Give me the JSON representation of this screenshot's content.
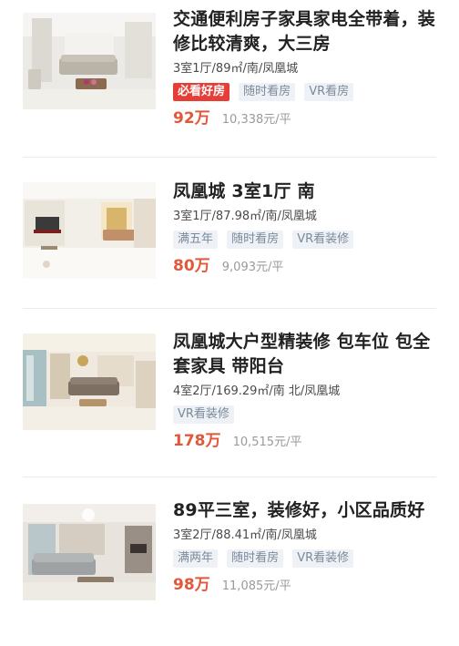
{
  "listings": [
    {
      "title": "交通便利房子家具家电全带着，装修比较清爽，大三房",
      "meta": "3室1厅/89㎡/南/凤凰城",
      "tags": [
        "必看好房",
        "随时看房",
        "VR看房"
      ],
      "price": "92万",
      "unit_price": "10,338元/平"
    },
    {
      "title": "凤凰城 3室1厅 南",
      "meta": "3室1厅/87.98㎡/南/凤凰城",
      "tags": [
        "满五年",
        "随时看房",
        "VR看装修"
      ],
      "price": "80万",
      "unit_price": "9,093元/平"
    },
    {
      "title": "凤凰城大户型精装修 包车位 包全套家具 带阳台",
      "meta": "4室2厅/169.29㎡/南 北/凤凰城",
      "tags": [
        "VR看装修"
      ],
      "price": "178万",
      "unit_price": "10,515元/平"
    },
    {
      "title": "89平三室，装修好，小区品质好",
      "meta": "3室2厅/88.41㎡/南/凤凰城",
      "tags": [
        "满两年",
        "随时看房",
        "VR看装修"
      ],
      "price": "98万",
      "unit_price": "11,085元/平"
    }
  ],
  "colors": {
    "price": "#e4573a",
    "hot_tag_bg": "#e63e37",
    "tag_bg": "#eef1f5",
    "tag_text": "#7b8a9b"
  }
}
